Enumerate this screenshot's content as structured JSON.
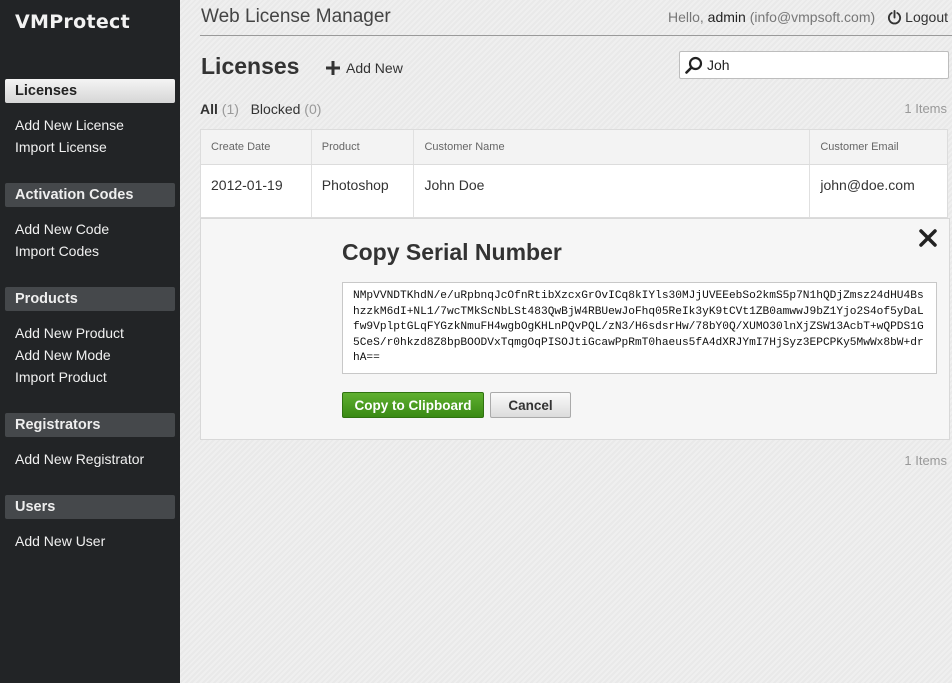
{
  "app": {
    "logo": "VMProtect",
    "title": "Web License Manager"
  },
  "user": {
    "greeting": "Hello,",
    "name": "admin",
    "email": "(info@vmpsoft.com)",
    "logout_label": "Logout"
  },
  "sidebar": {
    "sections": [
      {
        "title": "Licenses",
        "active": true,
        "links": [
          "Add New License",
          "Import License"
        ]
      },
      {
        "title": "Activation Codes",
        "links": [
          "Add New Code",
          "Import Codes"
        ]
      },
      {
        "title": "Products",
        "links": [
          "Add New Product",
          "Add New Mode",
          "Import Product"
        ]
      },
      {
        "title": "Registrators",
        "links": [
          "Add New Registrator"
        ]
      },
      {
        "title": "Users",
        "links": [
          "Add New User"
        ]
      }
    ]
  },
  "page": {
    "title": "Licenses",
    "add_new_label": "Add New",
    "search": {
      "value": "Joh"
    },
    "filters": [
      {
        "label": "All",
        "count": "(1)"
      },
      {
        "label": "Blocked",
        "count": "(0)"
      }
    ],
    "items_count": "1 Items"
  },
  "table": {
    "columns": [
      "Create Date",
      "Product",
      "Customer Name",
      "Customer Email"
    ],
    "rows": [
      [
        "2012-01-19",
        "Photoshop",
        "John Doe",
        "john@doe.com"
      ]
    ]
  },
  "panel": {
    "title": "Copy Serial Number",
    "serial": "NMpVVNDTKhdN/e/uRpbnqJcOfnRtibXzcxGrOvICq8kIYls30MJjUVEEebSo2kmS5p7N1hQDjZmsz24dHU4BshzzkM6dI+NL1/7wcTMkScNbLSt483QwBjW4RBUewJoFhq05ReIk3yK9tCVt1ZB0amwwJ9bZ1Yjo2S4of5yDaLfw9VplptGLqFYGzkNmuFH4wgbOgKHLnPQvPQL/zN3/H6sdsrHw/78bY0Q/XUMO30lnXjZSW13AcbT+wQPDS1G5CeS/r0hkzd8Z8bpBOODVxTqmgOqPISOJtiGcawPpRmT0haeus5fA4dXRJYmI7HjSyz3EPCPKy5MwWx8bW+drhA==",
    "copy_label": "Copy to Clipboard",
    "cancel_label": "Cancel"
  },
  "colors": {
    "sidebar_bg": "#222426",
    "copy_button": "#4a9c22"
  }
}
